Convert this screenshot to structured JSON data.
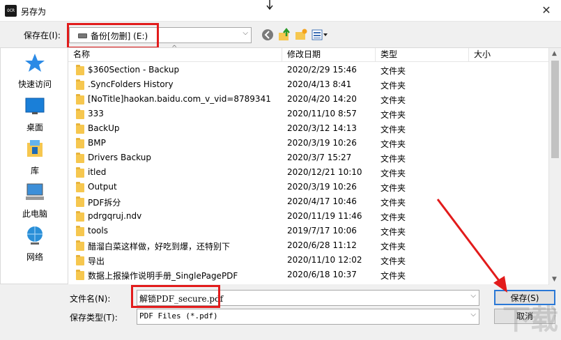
{
  "window": {
    "title": "另存为",
    "app_icon_text": "OCR",
    "close_glyph": "✕"
  },
  "location": {
    "label": "保存在(I):",
    "value": "备份[勿删] (E:)",
    "arrow": "⌵"
  },
  "toolbar": {
    "view_arrow": "▾"
  },
  "sidebar": {
    "items": [
      {
        "label": "快速访问"
      },
      {
        "label": "桌面"
      },
      {
        "label": "库"
      },
      {
        "label": "此电脑"
      },
      {
        "label": "网络"
      }
    ]
  },
  "columns": {
    "name": "名称",
    "modified": "修改日期",
    "type": "类型",
    "size": "大小",
    "sort_glyph": "^"
  },
  "files": [
    {
      "name": "$360Section - Backup",
      "date": "2020/2/29 15:46",
      "type": "文件夹"
    },
    {
      "name": ".SyncFolders History",
      "date": "2020/4/13 8:41",
      "type": "文件夹"
    },
    {
      "name": "[NoTitle]haokan.baidu.com_v_vid=8789341",
      "date": "2020/4/20 14:20",
      "type": "文件夹"
    },
    {
      "name": "333",
      "date": "2020/11/10 8:57",
      "type": "文件夹"
    },
    {
      "name": "BackUp",
      "date": "2020/3/12 14:13",
      "type": "文件夹"
    },
    {
      "name": "BMP",
      "date": "2020/3/19 10:26",
      "type": "文件夹"
    },
    {
      "name": "Drivers Backup",
      "date": "2020/3/7 15:27",
      "type": "文件夹"
    },
    {
      "name": "itled",
      "date": "2020/12/21 10:10",
      "type": "文件夹"
    },
    {
      "name": "Output",
      "date": "2020/3/19 10:26",
      "type": "文件夹"
    },
    {
      "name": "PDF拆分",
      "date": "2020/4/17 10:46",
      "type": "文件夹"
    },
    {
      "name": "pdrgqruj.ndv",
      "date": "2020/11/19 11:46",
      "type": "文件夹"
    },
    {
      "name": "tools",
      "date": "2019/7/17 10:06",
      "type": "文件夹"
    },
    {
      "name": "醋溜白菜这样做，好吃到爆，还特别下",
      "date": "2020/6/28 11:12",
      "type": "文件夹"
    },
    {
      "name": "导出",
      "date": "2020/11/10 12:02",
      "type": "文件夹"
    },
    {
      "name": "数据上报操作说明手册_SinglePagePDF",
      "date": "2020/6/18 10:37",
      "type": "文件夹"
    }
  ],
  "filename": {
    "label": "文件名(N):",
    "value": "解锁PDF_secure.pdf"
  },
  "filetype": {
    "label": "保存类型(T):",
    "value": "PDF Files (*.pdf)"
  },
  "buttons": {
    "save": "保存(S)",
    "cancel": "取消"
  },
  "watermark": "下载"
}
